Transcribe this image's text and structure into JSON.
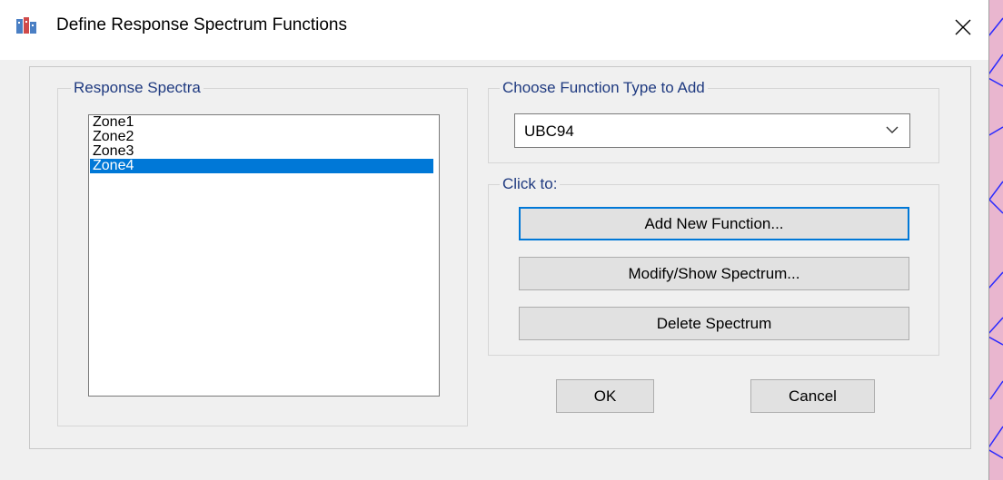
{
  "window": {
    "title": "Define Response Spectrum Functions"
  },
  "spectra_group": {
    "label": "Response Spectra",
    "items": [
      "Zone1",
      "Zone2",
      "Zone3",
      "Zone4"
    ],
    "selected": "Zone4"
  },
  "type_group": {
    "label": "Choose  Function Type to Add",
    "selected_value": "UBC94"
  },
  "click_group": {
    "label": "Click to:",
    "add_label": "Add New Function...",
    "modify_label": "Modify/Show Spectrum...",
    "delete_label": "Delete Spectrum"
  },
  "buttons": {
    "ok": "OK",
    "cancel": "Cancel"
  },
  "colors": {
    "selection": "#0078d7",
    "group_label": "#1f3a80",
    "background_app": "#e9b6cf"
  }
}
